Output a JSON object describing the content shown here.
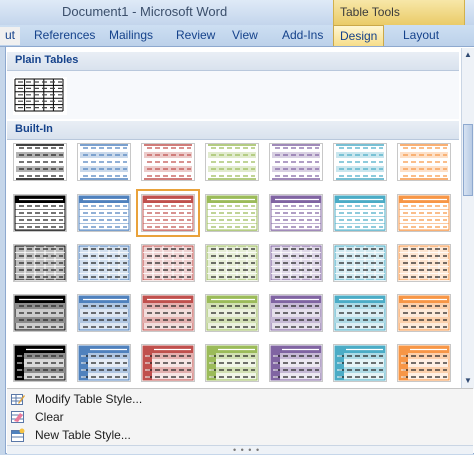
{
  "window": {
    "title": "Document1 - Microsoft Word",
    "context_tab": "Table Tools"
  },
  "ribbon_tabs": [
    {
      "label": "ut",
      "active": false
    },
    {
      "label": "References",
      "active": false
    },
    {
      "label": "Mailings",
      "active": false
    },
    {
      "label": "Review",
      "active": false
    },
    {
      "label": "View",
      "active": false
    },
    {
      "label": "Add-Ins",
      "active": false
    },
    {
      "label": "Design",
      "active": true
    },
    {
      "label": "Layout",
      "active": false
    }
  ],
  "gallery": {
    "sections": {
      "plain": "Plain Tables",
      "builtin": "Built-In"
    },
    "plain_styles": [
      {
        "name": "Table Grid",
        "color": "#000000"
      }
    ],
    "row_colors": [
      "#000000",
      "#4f81bd",
      "#c0504d",
      "#9bbb59",
      "#8064a2",
      "#4bacc6",
      "#f79646"
    ],
    "selected_style": {
      "row": 1,
      "column": 2
    }
  },
  "menu": [
    {
      "label": "Modify Table Style...",
      "icon": "modify-style-icon"
    },
    {
      "label": "Clear",
      "icon": "clear-icon"
    },
    {
      "label": "New Table Style...",
      "icon": "new-style-icon"
    }
  ]
}
